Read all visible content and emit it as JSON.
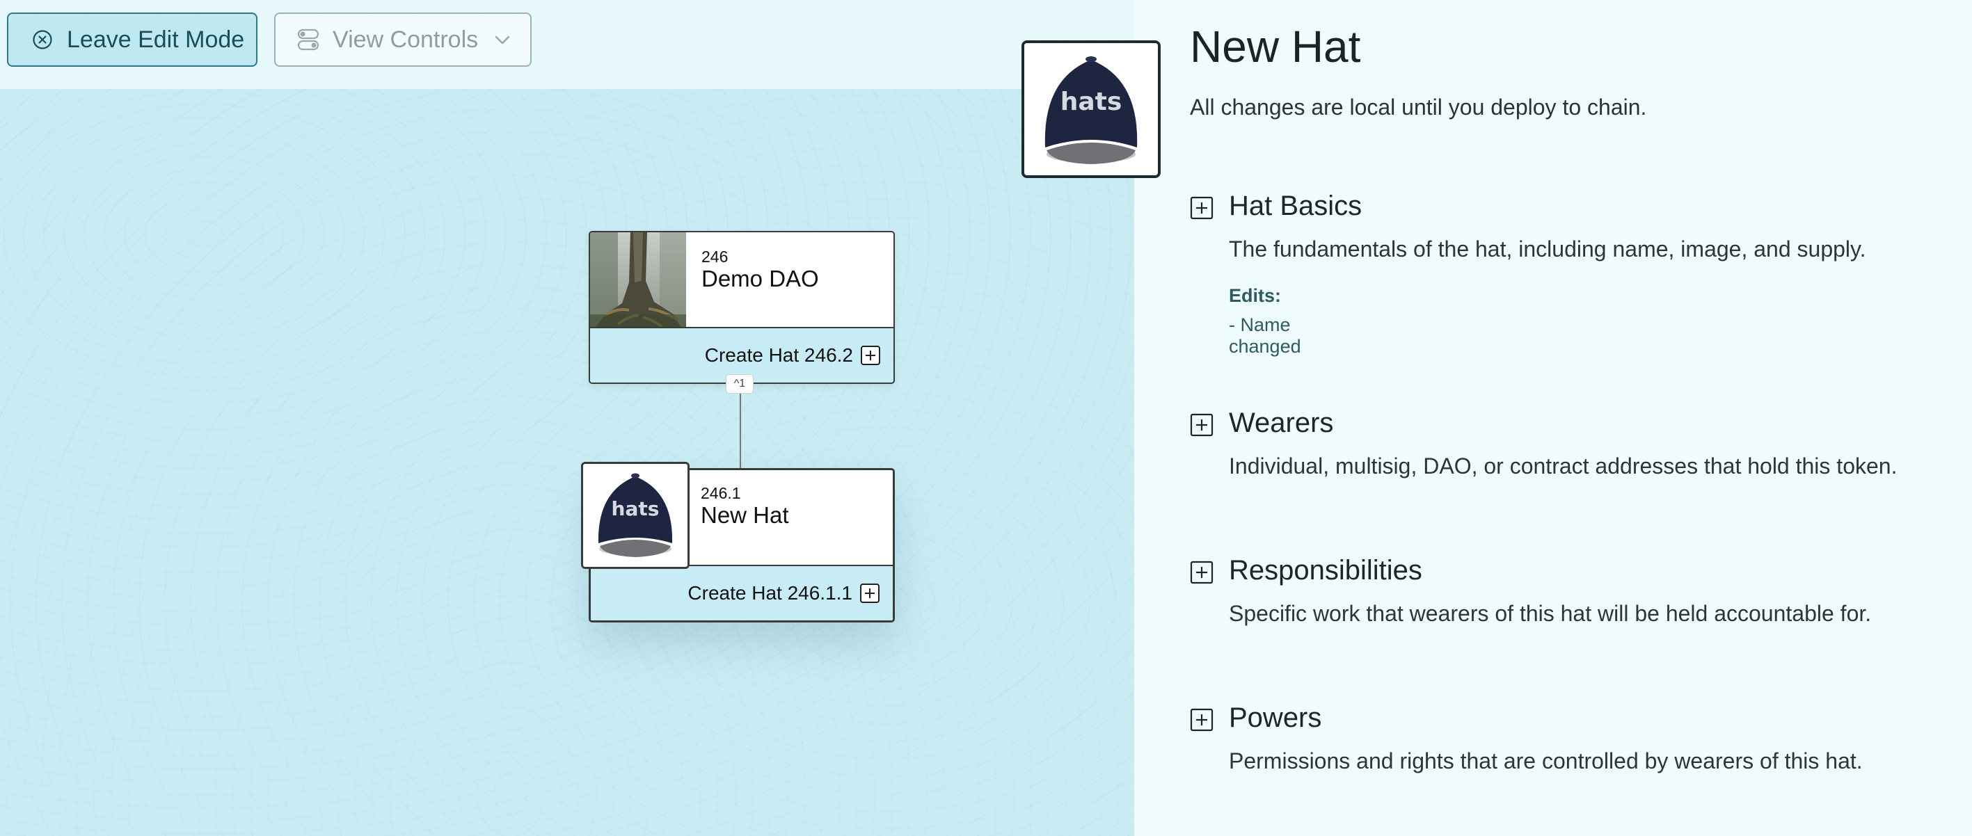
{
  "toolbar": {
    "leave_edit_label": "Leave Edit Mode",
    "view_controls_label": "View Controls"
  },
  "tree": {
    "connector_badge": "^1",
    "top_hat": {
      "id": "246",
      "name": "Demo DAO",
      "create_label": "Create Hat 246.2"
    },
    "child_hat": {
      "id": "246.1",
      "name": "New Hat",
      "create_label": "Create Hat 246.1.1",
      "image_text": "hats"
    }
  },
  "panel": {
    "title": "New Hat",
    "subtitle": "All changes are local until you deploy to chain.",
    "image_text": "hats",
    "sections": [
      {
        "title": "Hat Basics",
        "description": "The fundamentals of the hat, including name, image, and supply.",
        "edits_label": "Edits:",
        "edits": [
          "- Name changed"
        ]
      },
      {
        "title": "Wearers",
        "description": "Individual, multisig, DAO, or contract addresses that hold this token."
      },
      {
        "title": "Responsibilities",
        "description": "Specific work that wearers of this hat will be held accountable for."
      },
      {
        "title": "Powers",
        "description": "Permissions and rights that are controlled by wearers of this hat."
      }
    ]
  },
  "colors": {
    "canvas_bg": "#c9ecf4",
    "panel_bg": "#f0fbfd",
    "accent": "#2c7a8c",
    "edits_text": "#2d5a63"
  }
}
